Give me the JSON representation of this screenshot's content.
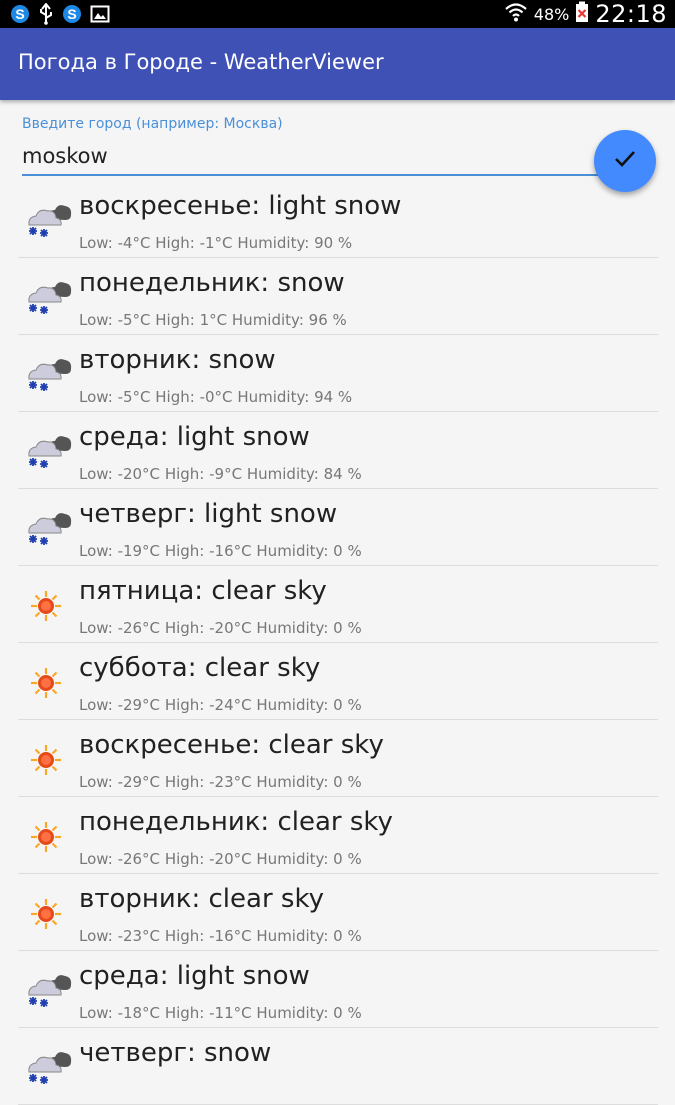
{
  "status_bar": {
    "battery_percent": "48%",
    "time": "22:18",
    "icons": [
      "s-app-icon",
      "usb-icon",
      "s-app-icon",
      "gallery-icon",
      "wifi-icon",
      "battery-icon"
    ]
  },
  "app_bar": {
    "title": "Погода в Городе - WeatherViewer",
    "color": "#3f51b5"
  },
  "city_input": {
    "label": "Введите город (например: Москва)",
    "value": "moskow",
    "accent_color": "#4a90d9"
  },
  "fab": {
    "icon": "check-icon",
    "color": "#448aff"
  },
  "forecast": [
    {
      "title": "воскресенье: light snow",
      "low_label": "Low:",
      "low": "-4°C",
      "high_label": "High:",
      "high": "-1°C",
      "humidity_label": "Humidity:",
      "humidity": "90 %",
      "icon": "snow-cloud-icon"
    },
    {
      "title": "понедельник: snow",
      "low_label": "Low:",
      "low": "-5°C",
      "high_label": "High:",
      "high": "1°C",
      "humidity_label": "Humidity:",
      "humidity": "96 %",
      "icon": "snow-cloud-icon"
    },
    {
      "title": "вторник: snow",
      "low_label": "Low:",
      "low": "-5°C",
      "high_label": "High:",
      "high": "-0°C",
      "humidity_label": "Humidity:",
      "humidity": "94 %",
      "icon": "snow-cloud-icon"
    },
    {
      "title": "среда: light snow",
      "low_label": "Low:",
      "low": "-20°C",
      "high_label": "High:",
      "high": "-9°C",
      "humidity_label": "Humidity:",
      "humidity": "84 %",
      "icon": "snow-cloud-icon"
    },
    {
      "title": "четверг: light snow",
      "low_label": "Low:",
      "low": "-19°C",
      "high_label": "High:",
      "high": "-16°C",
      "humidity_label": "Humidity:",
      "humidity": "0 %",
      "icon": "snow-cloud-icon"
    },
    {
      "title": "пятница: clear sky",
      "low_label": "Low:",
      "low": "-26°C",
      "high_label": "High:",
      "high": "-20°C",
      "humidity_label": "Humidity:",
      "humidity": "0 %",
      "icon": "sun-icon"
    },
    {
      "title": "суббота: clear sky",
      "low_label": "Low:",
      "low": "-29°C",
      "high_label": "High:",
      "high": "-24°C",
      "humidity_label": "Humidity:",
      "humidity": "0 %",
      "icon": "sun-icon"
    },
    {
      "title": "воскресенье: clear sky",
      "low_label": "Low:",
      "low": "-29°C",
      "high_label": "High:",
      "high": "-23°C",
      "humidity_label": "Humidity:",
      "humidity": "0 %",
      "icon": "sun-icon"
    },
    {
      "title": "понедельник: clear sky",
      "low_label": "Low:",
      "low": "-26°C",
      "high_label": "High:",
      "high": "-20°C",
      "humidity_label": "Humidity:",
      "humidity": "0 %",
      "icon": "sun-icon"
    },
    {
      "title": "вторник: clear sky",
      "low_label": "Low:",
      "low": "-23°C",
      "high_label": "High:",
      "high": "-16°C",
      "humidity_label": "Humidity:",
      "humidity": "0 %",
      "icon": "sun-icon"
    },
    {
      "title": "среда: light snow",
      "low_label": "Low:",
      "low": "-18°C",
      "high_label": "High:",
      "high": "-11°C",
      "humidity_label": "Humidity:",
      "humidity": "0 %",
      "icon": "snow-cloud-icon"
    },
    {
      "title": "четверг: snow",
      "icon": "snow-cloud-icon"
    }
  ]
}
